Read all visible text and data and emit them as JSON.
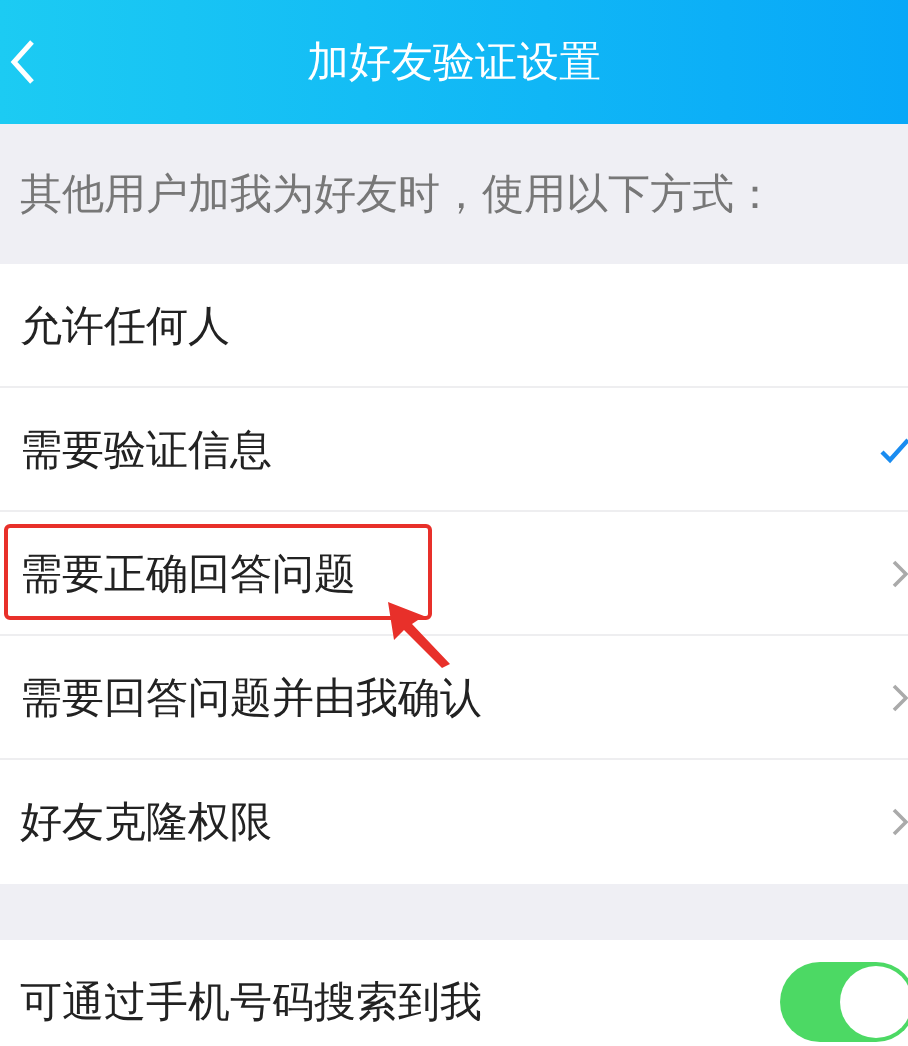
{
  "header": {
    "title": "加好友验证设置"
  },
  "hint": "其他用户加我为好友时，使用以下方式：",
  "options": [
    {
      "label": "允许任何人",
      "kind": "choice",
      "selected": false,
      "highlighted": false
    },
    {
      "label": "需要验证信息",
      "kind": "choice",
      "selected": true,
      "highlighted": false
    },
    {
      "label": "需要正确回答问题",
      "kind": "link",
      "highlighted": true
    },
    {
      "label": "需要回答问题并由我确认",
      "kind": "link",
      "highlighted": false
    },
    {
      "label": "好友克隆权限",
      "kind": "link",
      "highlighted": false
    }
  ],
  "toggles": [
    {
      "label": "可通过手机号码搜索到我",
      "on": true
    }
  ]
}
